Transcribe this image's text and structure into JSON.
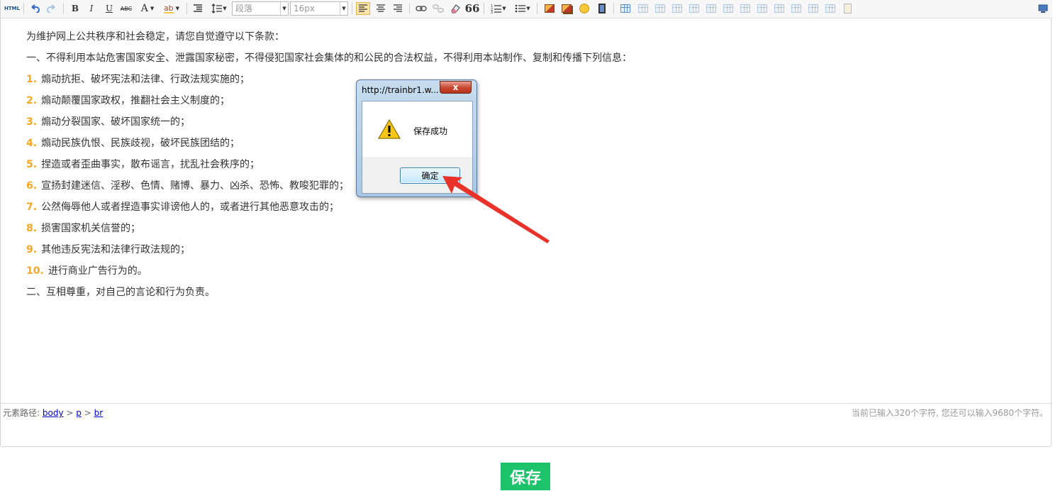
{
  "toolbar": {
    "html_label": "HTML",
    "bold": "B",
    "italic": "I",
    "underline": "U",
    "strike": "ABC",
    "font_color": "A",
    "highlight": "ab",
    "paragraph_select": "段落",
    "fontsize_select": "16px",
    "quote": "66"
  },
  "content": {
    "intro": "为维护网上公共秩序和社会稳定，请您自觉遵守以下条款：",
    "clause1": "一、不得利用本站危害国家安全、泄露国家秘密，不得侵犯国家社会集体的和公民的合法权益，不得利用本站制作、复制和传播下列信息：",
    "items": [
      {
        "num": "1.",
        "text": "煽动抗拒、破坏宪法和法律、行政法规实施的；"
      },
      {
        "num": "2.",
        "text": "煽动颠覆国家政权，推翻社会主义制度的；"
      },
      {
        "num": "3.",
        "text": "煽动分裂国家、破坏国家统一的；"
      },
      {
        "num": "4.",
        "text": "煽动民族仇恨、民族歧视，破坏民族团结的；"
      },
      {
        "num": "5.",
        "text": "捏造或者歪曲事实，散布谣言，扰乱社会秩序的；"
      },
      {
        "num": "6.",
        "text": "宣扬封建迷信、淫秽、色情、赌博、暴力、凶杀、恐怖、教唆犯罪的；"
      },
      {
        "num": "7.",
        "text": "公然侮辱他人或者捏造事实诽谤他人的，或者进行其他恶意攻击的；"
      },
      {
        "num": "8.",
        "text": "损害国家机关信誉的；"
      },
      {
        "num": "9.",
        "text": "其他违反宪法和法律行政法规的；"
      },
      {
        "num": "10.",
        "text": "进行商业广告行为的。"
      }
    ],
    "clause2": "二、互相尊重，对自己的言论和行为负责。"
  },
  "pathbar": {
    "label": "元素路径:",
    "crumbs": [
      "body",
      "p",
      "br"
    ],
    "sep": ">",
    "counter": "当前已输入320个字符, 您还可以输入9680个字符。"
  },
  "save_button": "保存",
  "dialog": {
    "title": "http://trainbr1.w...",
    "close": "x",
    "message": "保存成功",
    "ok": "确定"
  },
  "colors": {
    "accent_green": "#1cc36b",
    "list_number": "#f5a623",
    "arrow_red": "#e8322a"
  }
}
